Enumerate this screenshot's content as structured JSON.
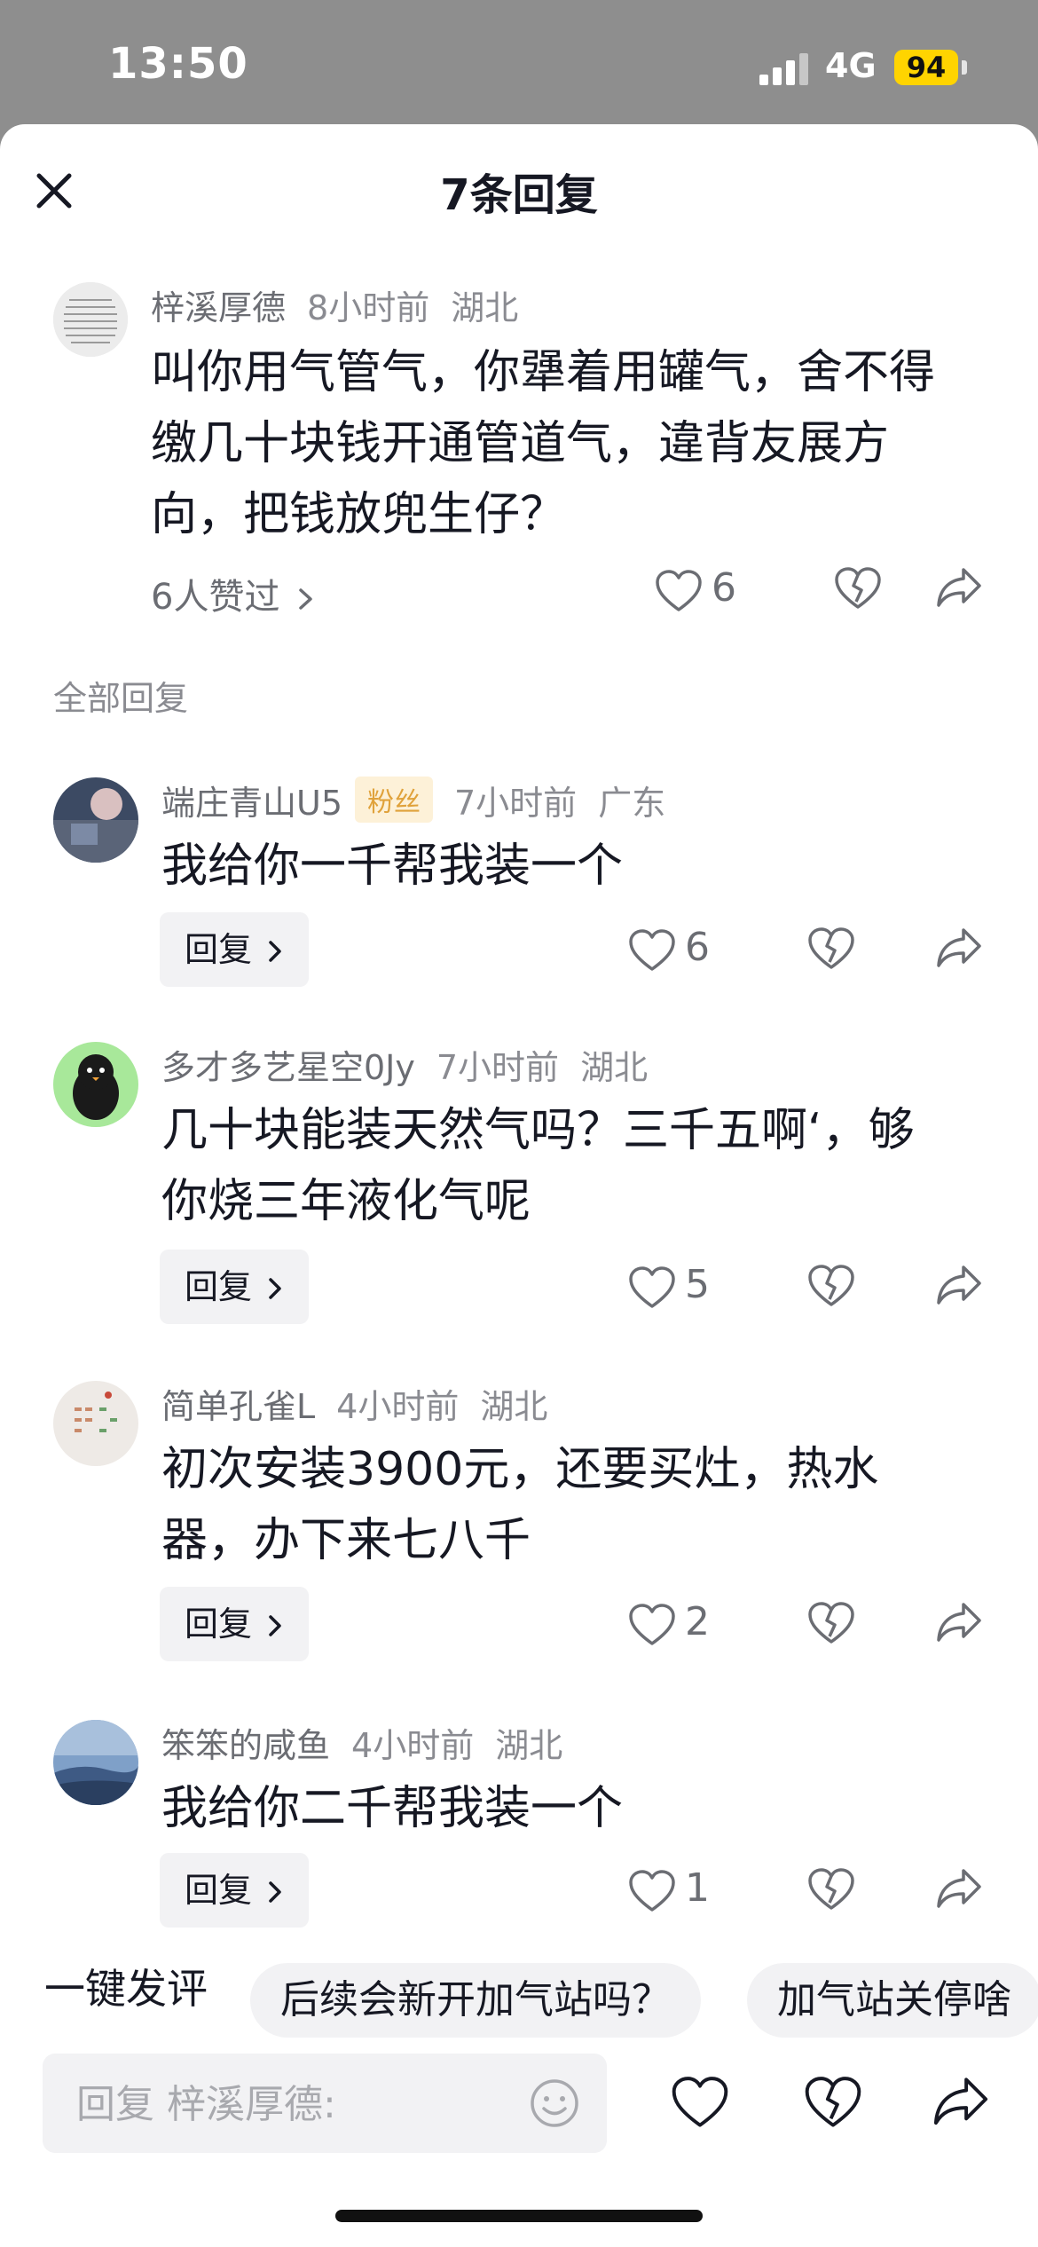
{
  "status": {
    "time": "13:50",
    "network": "4G",
    "battery": "94"
  },
  "header": {
    "title": "7条回复"
  },
  "main_comment": {
    "author": "梓溪厚德",
    "time": "8小时前",
    "location": "湖北",
    "text_lines": [
      "叫你用气管气，你犟着用罐气，舍不得",
      "缴几十块钱开通管道气，違背友展方",
      "向，把钱放兜生仔？"
    ],
    "liked_by": "6人赞过",
    "likes": "6"
  },
  "section_label": "全部回复",
  "replies": [
    {
      "author": "端庄青山U5",
      "badge": "粉丝",
      "time": "7小时前",
      "location": "广东",
      "text_lines": [
        "我给你一千帮我装一个"
      ],
      "reply_label": "回复",
      "likes": "6"
    },
    {
      "author": "多才多艺星空0Jy",
      "time": "7小时前",
      "location": "湖北",
      "text_lines": [
        "几十块能装天然气吗？三千五啊‘，够",
        "你烧三年液化气呢"
      ],
      "reply_label": "回复",
      "likes": "5"
    },
    {
      "author": "简单孔雀L",
      "time": "4小时前",
      "location": "湖北",
      "text_lines": [
        "初次安装3900元，还要买灶，热水",
        "器，办下来七八千"
      ],
      "reply_label": "回复",
      "likes": "2"
    },
    {
      "author": "笨笨的咸鱼",
      "time": "4小时前",
      "location": "湖北",
      "text_lines": [
        "我给你二千帮我装一个"
      ],
      "reply_label": "回复",
      "likes": "1"
    }
  ],
  "quick_comment": {
    "label": "一键发评",
    "chips": [
      "后续会新开加气站吗？",
      "加气站关停啥"
    ]
  },
  "input": {
    "placeholder": "回复 梓溪厚德:"
  },
  "colors": {
    "accent_badge": "#e0a23b",
    "battery": "#ffd400"
  },
  "icons": [
    "close-icon",
    "heart-icon",
    "broken-heart-icon",
    "share-icon",
    "emoji-icon",
    "chevron-right-icon"
  ]
}
